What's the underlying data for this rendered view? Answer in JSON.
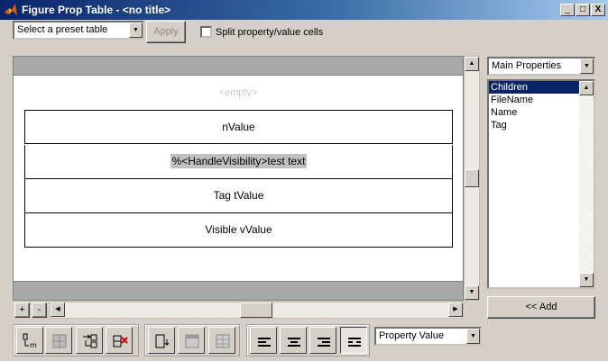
{
  "window": {
    "title": "Figure Prop Table - <no title>",
    "controls": {
      "minimize": "_",
      "maximize": "□",
      "close": "X"
    }
  },
  "toolbar": {
    "preset_select": {
      "value": "Select a preset table"
    },
    "apply_label": "Apply",
    "split_checkbox": {
      "label": "Split property/value cells",
      "checked": false
    }
  },
  "table": {
    "empty_text": "<empty>",
    "rows": [
      {
        "text": "nValue"
      },
      {
        "text": "%<HandleVisibility>test text",
        "editing": true
      },
      {
        "text": "Tag tValue"
      },
      {
        "text": "Visible vValue"
      }
    ]
  },
  "row_buttons": {
    "add": "+",
    "remove": "-"
  },
  "properties": {
    "category_select": {
      "value": "Main Properties"
    },
    "items": [
      "Children",
      "FileName",
      "Name",
      "Tag"
    ],
    "selected_index": 0,
    "add_button": "<< Add"
  },
  "bottom_toolbar": {
    "display_select": {
      "value": "Property Value"
    },
    "icons": [
      "insert-row-icon",
      "delete-cell-icon",
      "split-cell-icon",
      "delete-row-icon",
      "insert-column-icon",
      "merge-cells-icon",
      "grid-disabled-icon",
      "align-left-icon",
      "align-center-icon",
      "align-right-icon",
      "justify-icon"
    ]
  },
  "colors": {
    "titlebar_start": "#0a246a",
    "titlebar_end": "#a6caf0",
    "selection": "#0a246a",
    "header_bar": "#a8a8a8"
  }
}
